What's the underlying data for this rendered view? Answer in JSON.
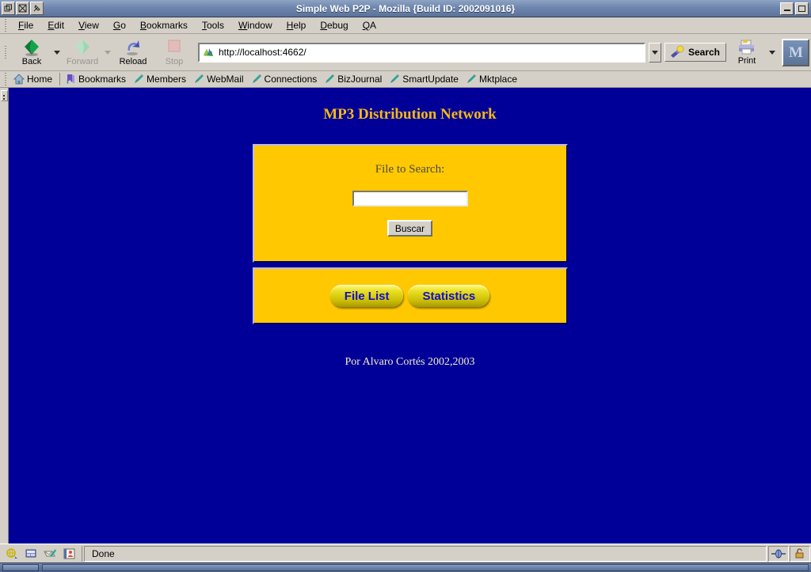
{
  "window": {
    "title": "Simple Web P2P - Mozilla {Build ID: 2002091016}",
    "controls": {
      "shade_icon": "window-shade-icon",
      "close_icon": "window-close-icon",
      "pin_icon": "window-pin-icon",
      "minimize_label": "",
      "maximize_label": ""
    }
  },
  "menubar": {
    "items": [
      {
        "label": "File",
        "accel": "F"
      },
      {
        "label": "Edit",
        "accel": "E"
      },
      {
        "label": "View",
        "accel": "V"
      },
      {
        "label": "Go",
        "accel": "G"
      },
      {
        "label": "Bookmarks",
        "accel": "B"
      },
      {
        "label": "Tools",
        "accel": "T"
      },
      {
        "label": "Window",
        "accel": "W"
      },
      {
        "label": "Help",
        "accel": "H"
      },
      {
        "label": "Debug",
        "accel": "D"
      },
      {
        "label": "QA",
        "accel": "Q"
      }
    ]
  },
  "toolbar": {
    "back_label": "Back",
    "forward_label": "Forward",
    "reload_label": "Reload",
    "stop_label": "Stop",
    "search_label": "Search",
    "print_label": "Print",
    "url_value": "http://localhost:4662/",
    "url_placeholder": "",
    "moz_logo_icon": "mozilla-logo-icon"
  },
  "personal_bar": {
    "items": [
      {
        "label": "Home",
        "icon": "home-icon"
      },
      {
        "label": "Bookmarks",
        "icon": "bookmark-ribbon-icon"
      },
      {
        "label": "Members",
        "icon": "pen-icon"
      },
      {
        "label": "WebMail",
        "icon": "pen-icon"
      },
      {
        "label": "Connections",
        "icon": "pen-icon"
      },
      {
        "label": "BizJournal",
        "icon": "pen-icon"
      },
      {
        "label": "SmartUpdate",
        "icon": "pen-icon"
      },
      {
        "label": "Mktplace",
        "icon": "pen-icon"
      }
    ]
  },
  "page": {
    "heading": "MP3 Distribution Network",
    "search_label": "File to Search:",
    "search_value": "",
    "search_placeholder": "",
    "submit_label": "Buscar",
    "file_list_label": "File List",
    "statistics_label": "Statistics",
    "footer": "Por Alvaro Cortés 2002,2003",
    "colors": {
      "background": "#000099",
      "panel": "#ffc800",
      "heading": "#f5b914",
      "footer_text": "#f2eec4",
      "pill_text": "#1010c8"
    }
  },
  "statusbar": {
    "icons": [
      "navigator-icon",
      "composer-icon",
      "mail-icon",
      "addressbook-icon"
    ],
    "message": "Done",
    "online_icon": "online-status-icon",
    "security_icon": "unlocked-padlock-icon"
  }
}
